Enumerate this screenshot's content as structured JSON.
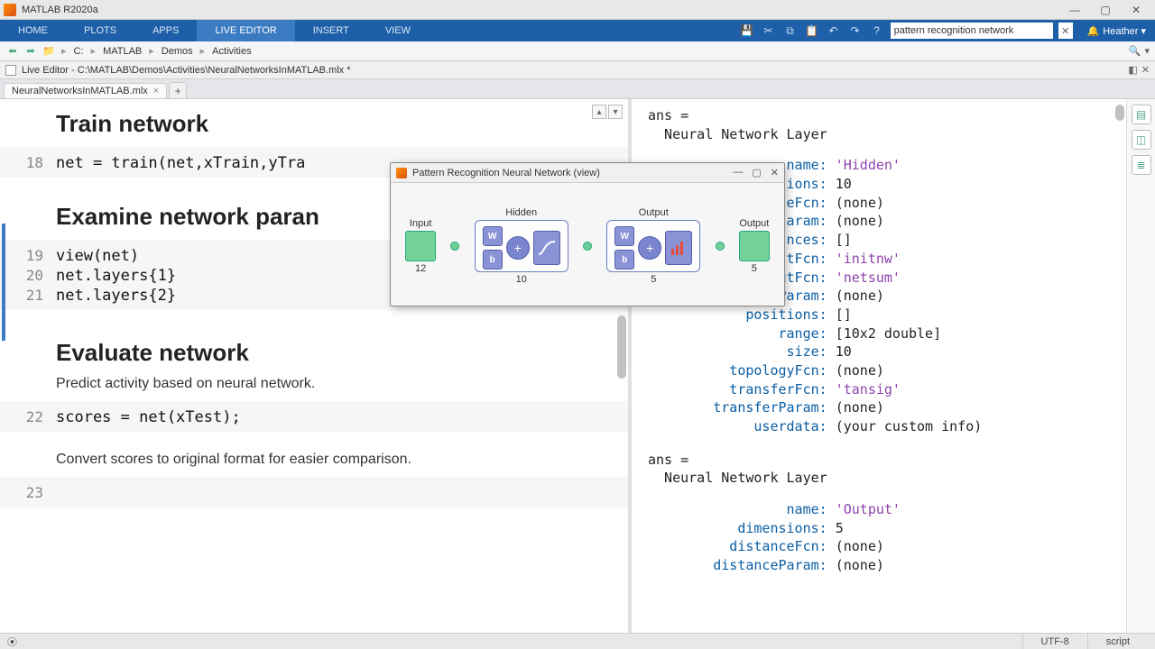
{
  "window": {
    "title": "MATLAB R2020a",
    "min": "—",
    "max": "▢",
    "close": "✕"
  },
  "toolstrip": {
    "tabs": [
      "HOME",
      "PLOTS",
      "APPS",
      "LIVE EDITOR",
      "INSERT",
      "VIEW"
    ],
    "active_index": 3,
    "search_placeholder": "pattern recognition network",
    "user": "Heather ▾"
  },
  "pathbar": {
    "crumbs": [
      "C:",
      "MATLAB",
      "Demos",
      "Activities"
    ]
  },
  "livebar": {
    "label": "Live Editor - C:\\MATLAB\\Demos\\Activities\\NeuralNetworksInMATLAB.mlx *"
  },
  "filetab": {
    "name": "NeuralNetworksInMATLAB.mlx",
    "dirty": "×"
  },
  "editor": {
    "h_train": "Train network",
    "line18": "net = train(net,xTrain,yTra",
    "h_examine": "Examine network paran",
    "line19": "view(net)",
    "line20": "net.layers{1}",
    "line21": "net.layers{2}",
    "h_eval": "Evaluate network",
    "p_eval": "Predict activity based on neural network.",
    "line22": "scores = net(xTest);",
    "p_conv": "Convert scores to original format for easier comparison.",
    "ln18": "18",
    "ln19": "19",
    "ln20": "20",
    "ln21": "21",
    "ln22": "22",
    "ln23": "23"
  },
  "output": {
    "ans1": "ans =",
    "layer1_type": "  Neural Network Layer",
    "l1": [
      [
        "name:",
        "'Hidden'"
      ],
      [
        "ions:",
        "10"
      ],
      [
        "eFcn:",
        "(none)"
      ],
      [
        "aram:",
        "(none)"
      ],
      [
        "nces:",
        "[]"
      ],
      [
        "tFcn:",
        "'initnw'"
      ],
      [
        "netinputFcn:",
        "'netsum'"
      ],
      [
        "netInputParam:",
        "(none)"
      ],
      [
        "positions:",
        "[]"
      ],
      [
        "range:",
        "[10x2 double]"
      ],
      [
        "size:",
        "10"
      ],
      [
        "topologyFcn:",
        "(none)"
      ],
      [
        "transferFcn:",
        "'tansig'"
      ],
      [
        "transferParam:",
        "(none)"
      ],
      [
        "userdata:",
        "(your custom info)"
      ]
    ],
    "ans2": "ans =",
    "layer2_type": "  Neural Network Layer",
    "l2": [
      [
        "name:",
        "'Output'"
      ],
      [
        "dimensions:",
        "5"
      ],
      [
        "distanceFcn:",
        "(none)"
      ],
      [
        "distanceParam:",
        "(none)"
      ]
    ]
  },
  "floatwin": {
    "title": "Pattern Recognition Neural Network (view)",
    "input_label": "Input",
    "hidden_label": "Hidden",
    "output_label": "Output",
    "out_label": "Output",
    "in_size": "12",
    "hidden_size": "10",
    "out_size": "5",
    "out_n": "5",
    "w": "W",
    "b": "b",
    "plus": "+"
  },
  "status": {
    "encoding": "UTF-8",
    "mode": "script"
  }
}
